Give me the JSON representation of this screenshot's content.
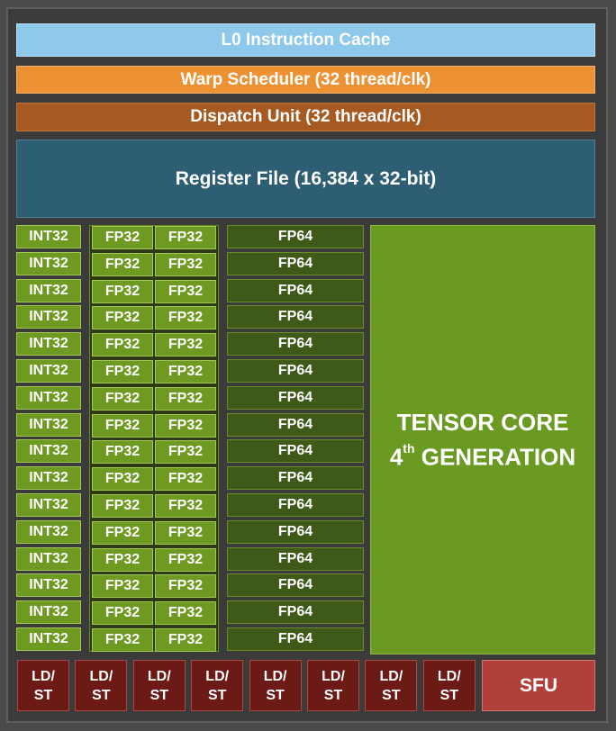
{
  "l0_cache": "L0 Instruction Cache",
  "warp_scheduler": "Warp Scheduler (32 thread/clk)",
  "dispatch_unit": "Dispatch Unit (32 thread/clk)",
  "register_file": "Register File (16,384 x 32-bit)",
  "int_label": "INT32",
  "fp32_label": "FP32",
  "fp64_label": "FP64",
  "unit_rows": 16,
  "tensor_core": {
    "line1": "TENSOR CORE",
    "line2_prefix": "4",
    "line2_sup": "th",
    "line2_suffix": " GENERATION"
  },
  "ldst": {
    "top": "LD/",
    "bottom": "ST",
    "count": 8
  },
  "sfu": "SFU",
  "colors": {
    "int_fp32_unit": "#6e9a22",
    "fp64_unit": "#3f5a18",
    "tensor_core": "#6a9a22",
    "ldst": "#6b1a16",
    "sfu": "#b2403a",
    "l0_cache": "#8ec8ea",
    "warp_scheduler": "#ec9233",
    "dispatch_unit": "#a65a22",
    "register_file": "#2d5e73"
  }
}
